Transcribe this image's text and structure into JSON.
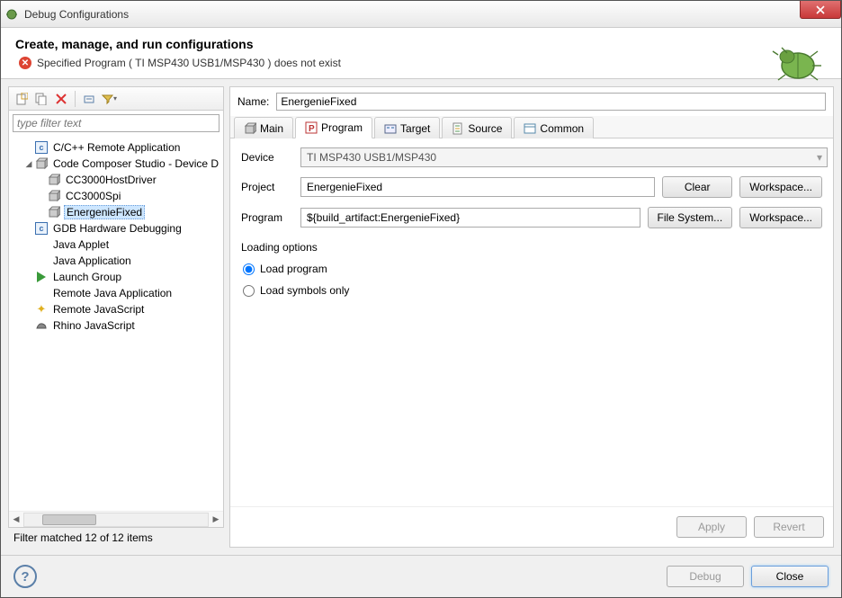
{
  "window": {
    "title": "Debug Configurations"
  },
  "banner": {
    "title": "Create, manage, and run configurations",
    "error": "Specified Program ( TI MSP430 USB1/MSP430 )  does not exist"
  },
  "filter": {
    "placeholder": "type filter text",
    "status": "Filter matched 12 of 12 items"
  },
  "tree": {
    "items": [
      {
        "label": "C/C++ Remote Application",
        "icon": "c",
        "depth": 1
      },
      {
        "label": "Code Composer Studio - Device D",
        "icon": "cube",
        "depth": 1,
        "expanded": true
      },
      {
        "label": "CC3000HostDriver",
        "icon": "cube",
        "depth": 2
      },
      {
        "label": "CC3000Spi",
        "icon": "cube",
        "depth": 2
      },
      {
        "label": "EnergenieFixed",
        "icon": "cube",
        "depth": 2,
        "selected": true
      },
      {
        "label": "GDB Hardware Debugging",
        "icon": "c",
        "depth": 1
      },
      {
        "label": "Java Applet",
        "icon": "",
        "depth": 1
      },
      {
        "label": "Java Application",
        "icon": "",
        "depth": 1
      },
      {
        "label": "Launch Group",
        "icon": "play",
        "depth": 1
      },
      {
        "label": "Remote Java Application",
        "icon": "",
        "depth": 1
      },
      {
        "label": "Remote JavaScript",
        "icon": "star",
        "depth": 1
      },
      {
        "label": "Rhino JavaScript",
        "icon": "rhino",
        "depth": 1
      }
    ]
  },
  "right": {
    "name_label": "Name:",
    "name_value": "EnergenieFixed",
    "tabs": [
      "Main",
      "Program",
      "Target",
      "Source",
      "Common"
    ],
    "active_tab": "Program",
    "device_label": "Device",
    "device_value": "TI MSP430 USB1/MSP430",
    "project_label": "Project",
    "project_value": "EnergenieFixed",
    "program_label": "Program",
    "program_value": "${build_artifact:EnergenieFixed}",
    "clear_btn": "Clear",
    "workspace_btn": "Workspace...",
    "filesystem_btn": "File System...",
    "loading_title": "Loading options",
    "radio_load_program": "Load program",
    "radio_load_symbols": "Load symbols only",
    "apply_btn": "Apply",
    "revert_btn": "Revert"
  },
  "footer": {
    "debug_btn": "Debug",
    "close_btn": "Close"
  }
}
